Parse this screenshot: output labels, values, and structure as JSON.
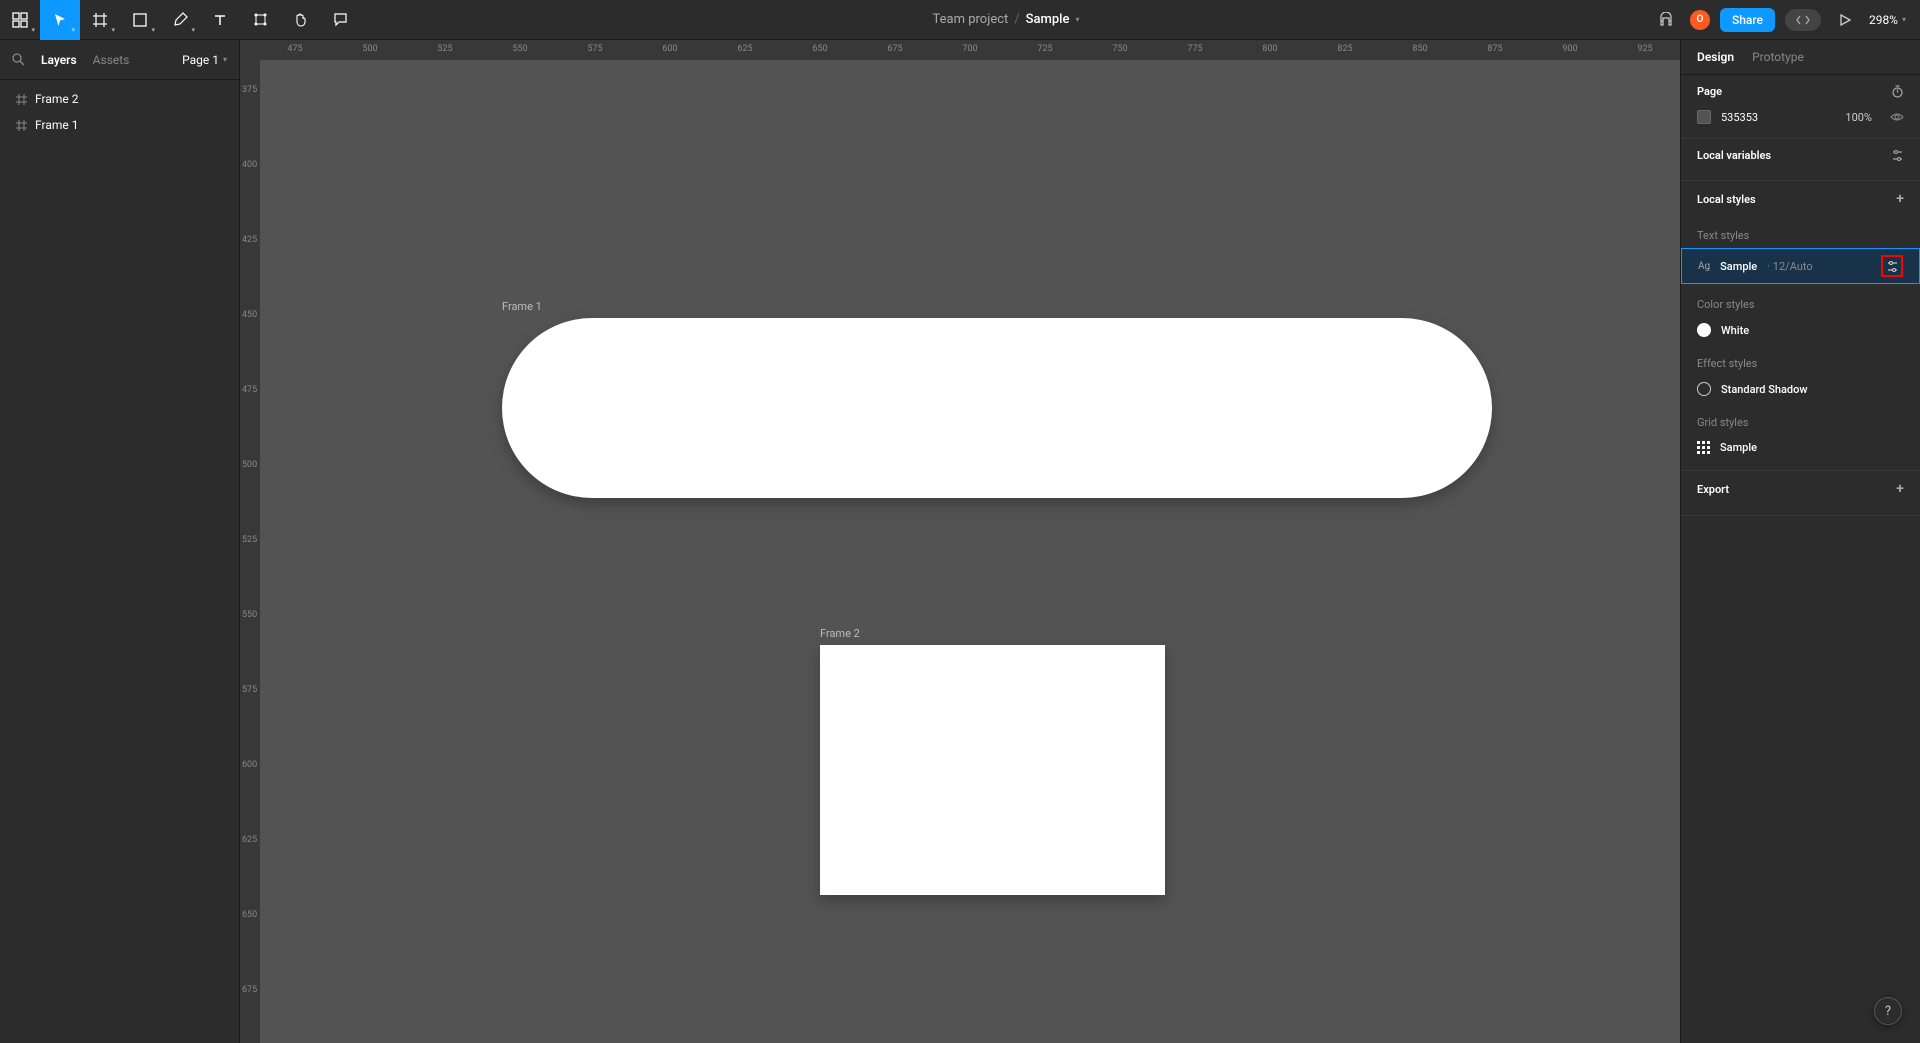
{
  "toolbar": {
    "team": "Team project",
    "file": "Sample",
    "share_label": "Share",
    "avatar_initial": "O",
    "zoom": "298%"
  },
  "left_panel": {
    "tabs": {
      "layers": "Layers",
      "assets": "Assets"
    },
    "page": "Page 1",
    "layers": [
      {
        "name": "Frame 2"
      },
      {
        "name": "Frame 1"
      }
    ]
  },
  "canvas": {
    "h_ticks": [
      "475",
      "500",
      "525",
      "550",
      "575",
      "600",
      "625",
      "650",
      "675",
      "700",
      "725",
      "750",
      "775",
      "800",
      "825",
      "850",
      "875",
      "900",
      "925"
    ],
    "v_ticks": [
      "375",
      "400",
      "425",
      "450",
      "475",
      "500",
      "525",
      "550",
      "575",
      "600",
      "625",
      "650",
      "675"
    ],
    "frames": [
      {
        "label": "Frame 1"
      },
      {
        "label": "Frame 2"
      }
    ]
  },
  "right_panel": {
    "tabs": {
      "design": "Design",
      "prototype": "Prototype"
    },
    "page": {
      "title": "Page",
      "color": "535353",
      "opacity": "100%"
    },
    "local_variables": {
      "title": "Local variables"
    },
    "local_styles": {
      "title": "Local styles"
    },
    "text_styles": {
      "title": "Text styles",
      "item": {
        "name": "Sample",
        "detail": "· 12/Auto",
        "prefix": "Ag"
      }
    },
    "color_styles": {
      "title": "Color styles",
      "item": {
        "name": "White"
      }
    },
    "effect_styles": {
      "title": "Effect styles",
      "item": {
        "name": "Standard Shadow"
      }
    },
    "grid_styles": {
      "title": "Grid styles",
      "item": {
        "name": "Sample"
      }
    },
    "export": {
      "title": "Export"
    }
  },
  "help": "?"
}
